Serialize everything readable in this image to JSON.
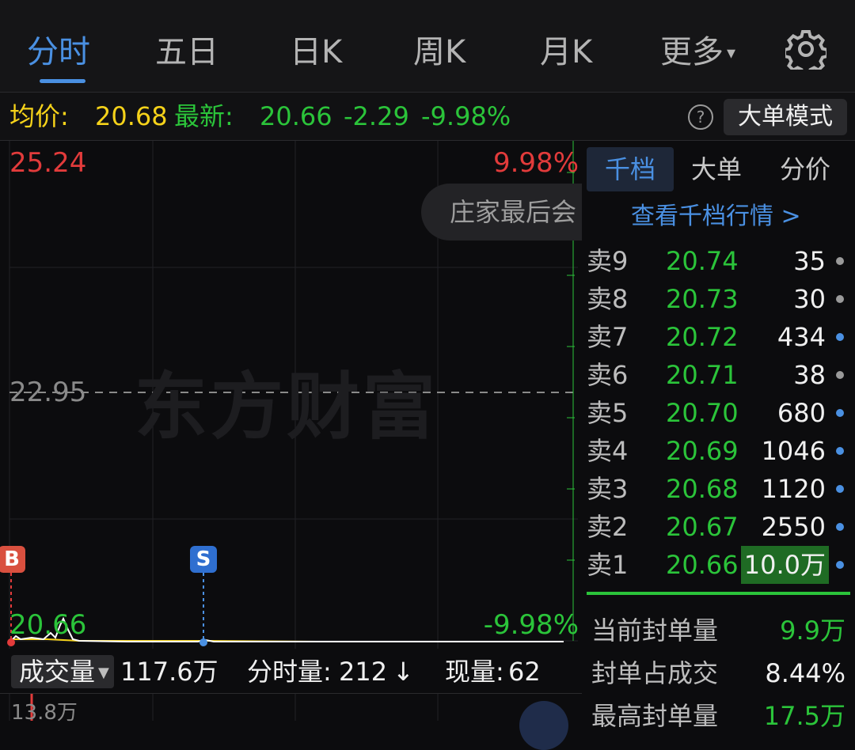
{
  "tabs": [
    {
      "label": "分时",
      "active": true
    },
    {
      "label": "五日"
    },
    {
      "label": "日K"
    },
    {
      "label": "周K"
    },
    {
      "label": "月K"
    },
    {
      "label": "更多"
    }
  ],
  "settings_icon": "gear-icon",
  "quote": {
    "avg_label": "均价:",
    "avg_value": "20.68",
    "latest_label": "最新:",
    "latest_value": "20.66",
    "change": "-2.29",
    "change_pct": "-9.98%",
    "help_icon": "?",
    "mode_button": "大单模式"
  },
  "chart": {
    "top_price": "25.24",
    "top_pct": "9.98%",
    "mid_price": "22.95",
    "bottom_price": "20.66",
    "bottom_pct": "-9.98%",
    "watermark": "东方财富",
    "banner_text": "庄家最后会",
    "marker_buy": "B",
    "marker_sell": "S",
    "colors": {
      "up": "#e23b3b",
      "down": "#2bc43a",
      "avg": "#f5d21a",
      "price": "#ffffff",
      "accent": "#4a90e2"
    }
  },
  "volume_bar": {
    "select_label": "成交量",
    "total": "117.6万",
    "minute_label": "分时量:",
    "minute_value": "212",
    "minute_arrow": "↓",
    "current_label": "现量:",
    "current_value": "62",
    "axis_label": "13.8万"
  },
  "panel": {
    "tabs": [
      {
        "label": "千档",
        "active": true
      },
      {
        "label": "大单"
      },
      {
        "label": "分价"
      }
    ],
    "link": "查看千档行情 >",
    "order_book": [
      {
        "label": "卖9",
        "price": "20.74",
        "volume": "35",
        "dot": "#9a9a9a"
      },
      {
        "label": "卖8",
        "price": "20.73",
        "volume": "30",
        "dot": "#9a9a9a"
      },
      {
        "label": "卖7",
        "price": "20.72",
        "volume": "434",
        "dot": "#4a90e2"
      },
      {
        "label": "卖6",
        "price": "20.71",
        "volume": "38",
        "dot": "#9a9a9a"
      },
      {
        "label": "卖5",
        "price": "20.70",
        "volume": "680",
        "dot": "#4a90e2"
      },
      {
        "label": "卖4",
        "price": "20.69",
        "volume": "1046",
        "dot": "#4a90e2"
      },
      {
        "label": "卖3",
        "price": "20.68",
        "volume": "1120",
        "dot": "#4a90e2"
      },
      {
        "label": "卖2",
        "price": "20.67",
        "volume": "2550",
        "dot": "#4a90e2"
      },
      {
        "label": "卖1",
        "price": "20.66",
        "volume": "10.0万",
        "dot": "#4a90e2",
        "highlight": true
      }
    ],
    "stats": [
      {
        "label": "当前封单量",
        "value": "9.9万",
        "color": "#2bc43a"
      },
      {
        "label": "封单占成交",
        "value": "8.44%",
        "color": "#f0f0f0"
      },
      {
        "label": "最高封单量",
        "value": "17.5万",
        "color": "#2bc43a"
      }
    ]
  }
}
